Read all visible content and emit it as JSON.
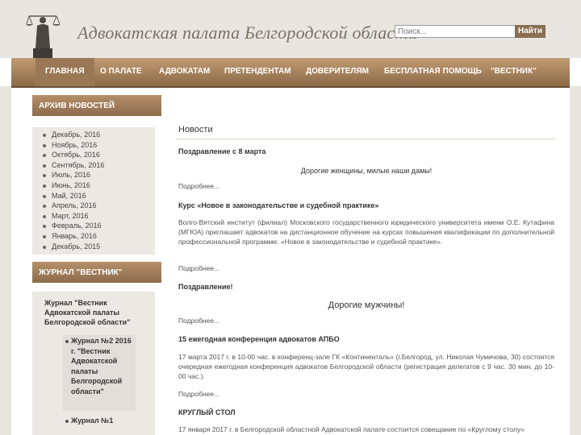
{
  "header": {
    "site_title": "Адвокатская палата Белгородской области",
    "search_placeholder": "Поиск...",
    "search_button": "Найти"
  },
  "nav": {
    "items": [
      {
        "label": "ГЛАВНАЯ"
      },
      {
        "label": "О ПАЛАТЕ"
      },
      {
        "label": "АДВОКАТАМ"
      },
      {
        "label": "ПРЕТЕНДЕНТАМ"
      },
      {
        "label": "ДОВЕРИТЕЛЯМ"
      },
      {
        "label": "БЕСПЛАТНАЯ ПОМОЩЬ"
      },
      {
        "label": "\"ВЕСТНИК\""
      }
    ]
  },
  "sidebar": {
    "archive_title": "АРХИВ НОВОСТЕЙ",
    "archive_items": [
      "Декабрь, 2016",
      "Ноябрь, 2016",
      "Октябрь, 2016",
      "Сентябрь, 2016",
      "Июль, 2016",
      "Июнь, 2016",
      "Май, 2016",
      "Апрель, 2016",
      "Март, 2016",
      "Февраль, 2016",
      "Январь, 2016",
      "Декабрь, 2015"
    ],
    "journal_title": "ЖУРНАЛ \"ВЕСТНИК\"",
    "journal_name": "Журнал \"Вестник Адвокатской палаты Белгородской области\"",
    "journal_items": [
      "Журнал №2 2016 г. \"Вестник Адвокатской палаты Белгородской области\"",
      "Журнал №1"
    ]
  },
  "content": {
    "title": "Новости",
    "more_label": "Подробнее...",
    "news": [
      {
        "title": "Поздравление с 8 марта",
        "lead": "Дорогие женщины, милые наши дамы!"
      },
      {
        "title": "Курс «Новое в законодательстве и судебной практике»",
        "body": "Волго-Вятский институт (филиал) Московского государственного юридического университета имени О.Е. Кутафина (МГЮА) приглашает адвокатов на дистанционное обучение на курсах повышения квалификации по дополнительной профессиональной программе: «Новое в законодательстве и судебной практике»."
      },
      {
        "title": "Поздравление!",
        "lead": "Дорогие мужчины!"
      },
      {
        "title": "15 ежегодная конференция адвокатов АПБО",
        "body": "17 марта 2017 г. в 10-00 час. в конференц-зале ГК «Континенталь» (г.Белгород, ул. Николая Чумичова, 30) состоится очередная ежегодная конференция адвокатов Белгородской области (регистрация делегатов с 9 час. 30 мин. до 10-00 час.)."
      },
      {
        "title": "КРУГЛЫЙ СТОЛ",
        "body": "17 января 2017 г. в Белгородской областной Адвокатской палате состоится совещание по «Круглому столу»"
      }
    ]
  }
}
